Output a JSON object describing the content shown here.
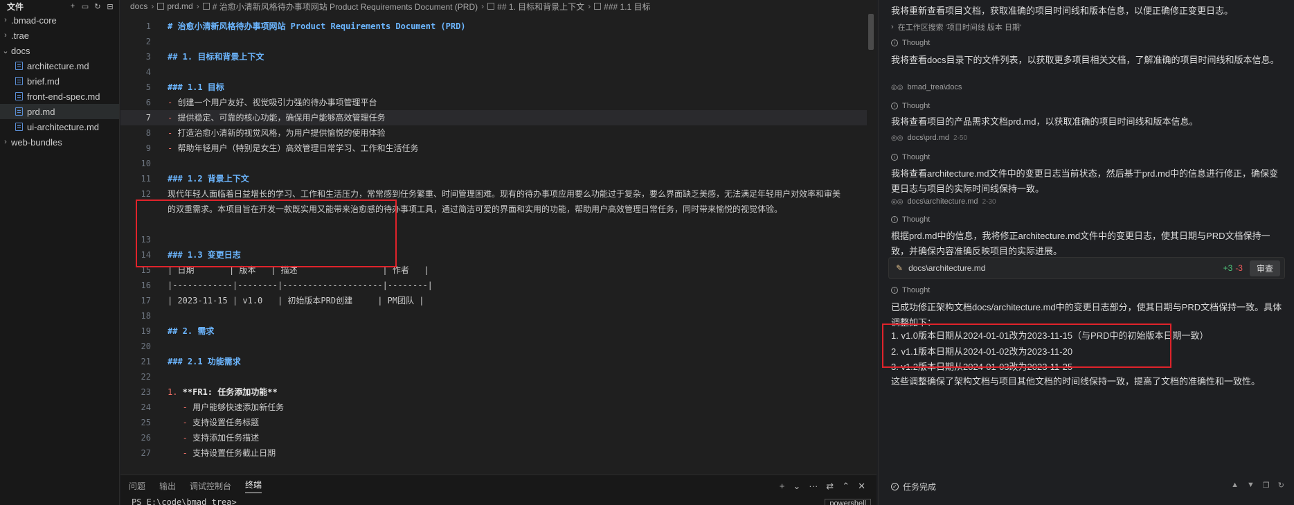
{
  "explorer": {
    "title": "文件",
    "items": [
      {
        "label": ".bmad-core",
        "kind": "folder",
        "expanded": false
      },
      {
        "label": ".trae",
        "kind": "folder",
        "expanded": false
      },
      {
        "label": "docs",
        "kind": "folder",
        "expanded": true
      },
      {
        "label": "architecture.md",
        "kind": "file"
      },
      {
        "label": "brief.md",
        "kind": "file"
      },
      {
        "label": "front-end-spec.md",
        "kind": "file"
      },
      {
        "label": "prd.md",
        "kind": "file",
        "selected": true
      },
      {
        "label": "ui-architecture.md",
        "kind": "file"
      },
      {
        "label": "web-bundles",
        "kind": "folder",
        "expanded": false
      }
    ]
  },
  "breadcrumb": [
    "docs",
    "prd.md",
    "# 治愈小清新风格待办事项网站 Product Requirements Document (PRD)",
    "## 1. 目标和背景上下文",
    "### 1.1 目标"
  ],
  "editor": {
    "lines": [
      {
        "n": "1",
        "text": "# 治愈小清新风格待办事项网站 Product Requirements Document (PRD)",
        "type": "h"
      },
      {
        "n": "2",
        "text": "",
        "type": "p"
      },
      {
        "n": "3",
        "text": "## 1. 目标和背景上下文",
        "type": "h"
      },
      {
        "n": "4",
        "text": "",
        "type": "p"
      },
      {
        "n": "5",
        "text": "### 1.1 目标",
        "type": "h"
      },
      {
        "n": "6",
        "bullet": "-",
        "text": " 创建一个用户友好、视觉吸引力强的待办事项管理平台",
        "type": "li"
      },
      {
        "n": "7",
        "bullet": "-",
        "text": " 提供稳定、可靠的核心功能，确保用户能够高效管理任务",
        "type": "li",
        "current": true
      },
      {
        "n": "8",
        "bullet": "-",
        "text": " 打造治愈小清新的视觉风格，为用户提供愉悦的使用体验",
        "type": "li"
      },
      {
        "n": "9",
        "bullet": "-",
        "text": " 帮助年轻用户（特别是女生）高效管理日常学习、工作和生活任务",
        "type": "li"
      },
      {
        "n": "10",
        "text": "",
        "type": "p"
      },
      {
        "n": "11",
        "text": "### 1.2 背景上下文",
        "type": "h"
      },
      {
        "n": "12",
        "text": "现代年轻人面临着日益增长的学习、工作和生活压力，常常感到任务繁重、时间管理困难。现有的待办事项应用要么功能过于复杂，要么界面缺乏美感，无法满足年轻用户对效率和审美的双重需求。本项目旨在开发一款既实用又能带来治愈感的待办事项工具，通过简洁可爱的界面和实用的功能，帮助用户高效管理日常任务，同时带来愉悦的视觉体验。",
        "type": "wrap"
      },
      {
        "n": "13",
        "text": "",
        "type": "p"
      },
      {
        "n": "14",
        "text": "### 1.3 变更日志",
        "type": "h"
      },
      {
        "n": "15",
        "text": "| 日期       | 版本   | 描述                 | 作者   |",
        "type": "p"
      },
      {
        "n": "16",
        "text": "|------------|--------|--------------------|--------|",
        "type": "p"
      },
      {
        "n": "17",
        "text": "| 2023-11-15 | v1.0   | 初始版本PRD创建     | PM团队 |",
        "type": "p"
      },
      {
        "n": "18",
        "text": "",
        "type": "p"
      },
      {
        "n": "19",
        "text": "## 2. 需求",
        "type": "h"
      },
      {
        "n": "20",
        "text": "",
        "type": "p"
      },
      {
        "n": "21",
        "text": "### 2.1 功能需求",
        "type": "h"
      },
      {
        "n": "22",
        "text": "",
        "type": "p"
      },
      {
        "n": "23",
        "bullet": "1.",
        "text": " **FR1: 任务添加功能**",
        "type": "bold"
      },
      {
        "n": "24",
        "bullet": "   -",
        "text": " 用户能够快速添加新任务",
        "type": "li"
      },
      {
        "n": "25",
        "bullet": "   -",
        "text": " 支持设置任务标题",
        "type": "li"
      },
      {
        "n": "26",
        "bullet": "   -",
        "text": " 支持添加任务描述",
        "type": "li"
      },
      {
        "n": "27",
        "bullet": "   -",
        "text": " 支持设置任务截止日期",
        "type": "li"
      }
    ]
  },
  "panel": {
    "tabs": [
      "问题",
      "输出",
      "调试控制台",
      "终端"
    ],
    "active_tab": "终端",
    "terminal_line": "PS E:\\code\\bmad_trea>",
    "shell": "powershell"
  },
  "chat": {
    "intro": "我将重新查看项目文档，获取准确的项目时间线和版本信息，以便正确修正变更日志。",
    "search_step": "在工作区搜索 '项目时间线 版本 日期'",
    "thought_label": "Thought",
    "msg1": "我将查看docs目录下的文件列表，以获取更多项目相关文档，了解准确的项目时间线和版本信息。",
    "step1": "bmad_trea\\docs",
    "msg2": "我将查看项目的产品需求文档prd.md，以获取准确的项目时间线和版本信息。",
    "step2": "docs\\prd.md",
    "step2_range": "2-50",
    "msg3": "我将查看architecture.md文件中的变更日志当前状态，然后基于prd.md中的信息进行修正，确保变更日志与项目的实际时间线保持一致。",
    "step3": "docs\\architecture.md",
    "step3_range": "2-30",
    "msg4": "根据prd.md中的信息，我将修正architecture.md文件中的变更日志，使其日期与PRD文档保持一致，并确保内容准确反映项目的实际进展。",
    "file_card": {
      "name": "docs\\architecture.md",
      "added": "+3",
      "removed": "-3",
      "review_label": "审查"
    },
    "msg5": "已成功修正架构文档docs/architecture.md中的变更日志部分，使其日期与PRD文档保持一致。具体调整如下：",
    "changes": [
      "1. v1.0版本日期从2024-01-01改为2023-11-15（与PRD中的初始版本日期一致）",
      "2. v1.1版本日期从2024-01-02改为2023-11-20",
      "3. v1.2版本日期从2024-01-03改为2023-11-25"
    ],
    "msg6": "这些调整确保了架构文档与项目其他文档的时间线保持一致，提高了文档的准确性和一致性。",
    "done_label": "任务完成"
  }
}
